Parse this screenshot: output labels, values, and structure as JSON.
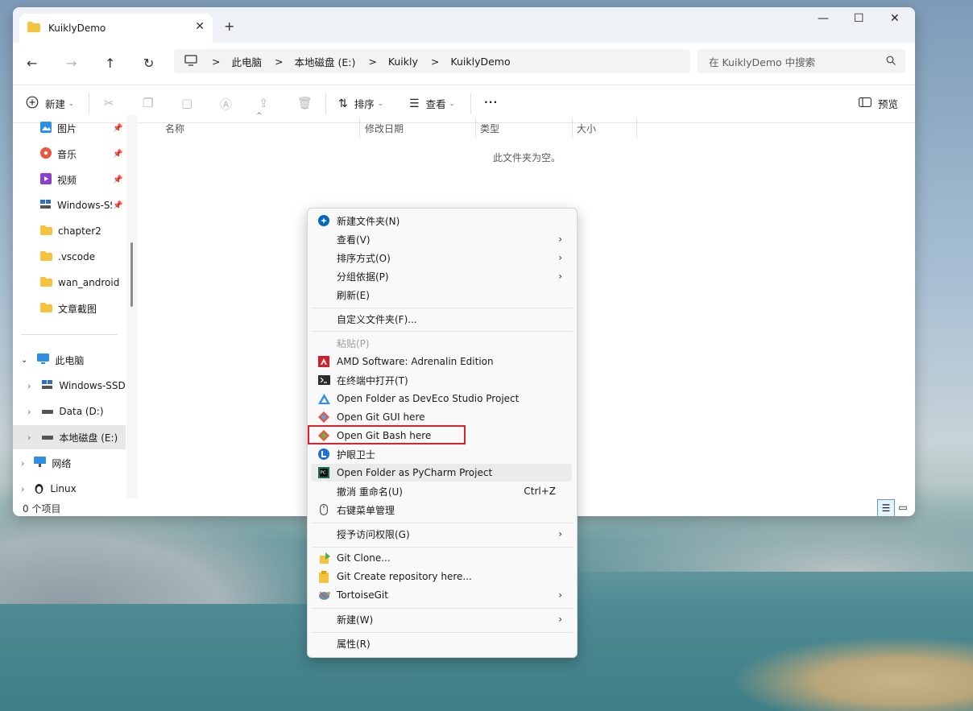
{
  "window": {
    "tab_title": "KuiklyDemo",
    "tab_close": "✕",
    "new_tab": "+",
    "minimize": "—",
    "maximize": "☐",
    "close": "✕"
  },
  "nav": {
    "back": "←",
    "forward": "→",
    "up": "↑",
    "refresh": "↻",
    "breadcrumb": [
      "此电脑",
      "本地磁盘 (E:)",
      "Kuikly",
      "KuiklyDemo"
    ],
    "sep": ">",
    "search_placeholder": "在 KuiklyDemo 中搜索"
  },
  "toolbar": {
    "new_label": "新建",
    "sort_label": "排序",
    "view_label": "查看",
    "more": "···",
    "preview_label": "预览"
  },
  "sidebar": {
    "items": [
      {
        "label": "图片",
        "icon": "pictures-icon"
      },
      {
        "label": "音乐",
        "icon": "music-icon"
      },
      {
        "label": "视频",
        "icon": "video-icon"
      },
      {
        "label": "Windows-SSD",
        "icon": "drive-icon"
      },
      {
        "label": "chapter2",
        "icon": "folder-icon"
      },
      {
        "label": ".vscode",
        "icon": "folder-icon"
      },
      {
        "label": "wan_android",
        "icon": "folder-icon"
      },
      {
        "label": "文章截图",
        "icon": "folder-icon"
      }
    ],
    "tree": [
      {
        "label": "此电脑"
      },
      {
        "label": "Windows-SSD"
      },
      {
        "label": "Data (D:)"
      },
      {
        "label": "本地磁盘 (E:)"
      },
      {
        "label": "网络"
      },
      {
        "label": "Linux"
      }
    ]
  },
  "columns": [
    "名称",
    "修改日期",
    "类型",
    "大小"
  ],
  "empty_text": "此文件夹为空。",
  "status": "0 个项目",
  "context_menu": {
    "items": [
      {
        "label": "新建文件夹(N)"
      },
      {
        "label": "查看(V)"
      },
      {
        "label": "排序方式(O)"
      },
      {
        "label": "分组依据(P)"
      },
      {
        "label": "刷新(E)"
      },
      {
        "label": "自定义文件夹(F)..."
      },
      {
        "label": "粘贴(P)"
      },
      {
        "label": "AMD Software: Adrenalin Edition"
      },
      {
        "label": "在终端中打开(T)"
      },
      {
        "label": "Open Folder as DevEco Studio Project"
      },
      {
        "label": "Open Git GUI here"
      },
      {
        "label": "Open Git Bash here"
      },
      {
        "label": "护眼卫士"
      },
      {
        "label": "Open Folder as PyCharm Project"
      },
      {
        "label": "撤消 重命名(U)",
        "shortcut": "Ctrl+Z"
      },
      {
        "label": "右键菜单管理"
      },
      {
        "label": "授予访问权限(G)"
      },
      {
        "label": "Git Clone..."
      },
      {
        "label": "Git Create repository here..."
      },
      {
        "label": "TortoiseGit"
      },
      {
        "label": "新建(W)"
      },
      {
        "label": "属性(R)"
      }
    ]
  },
  "colors": {
    "highlight_border": "#e0202a",
    "folder_yellow": "#f5c342",
    "accent_blue": "#0067c0"
  }
}
